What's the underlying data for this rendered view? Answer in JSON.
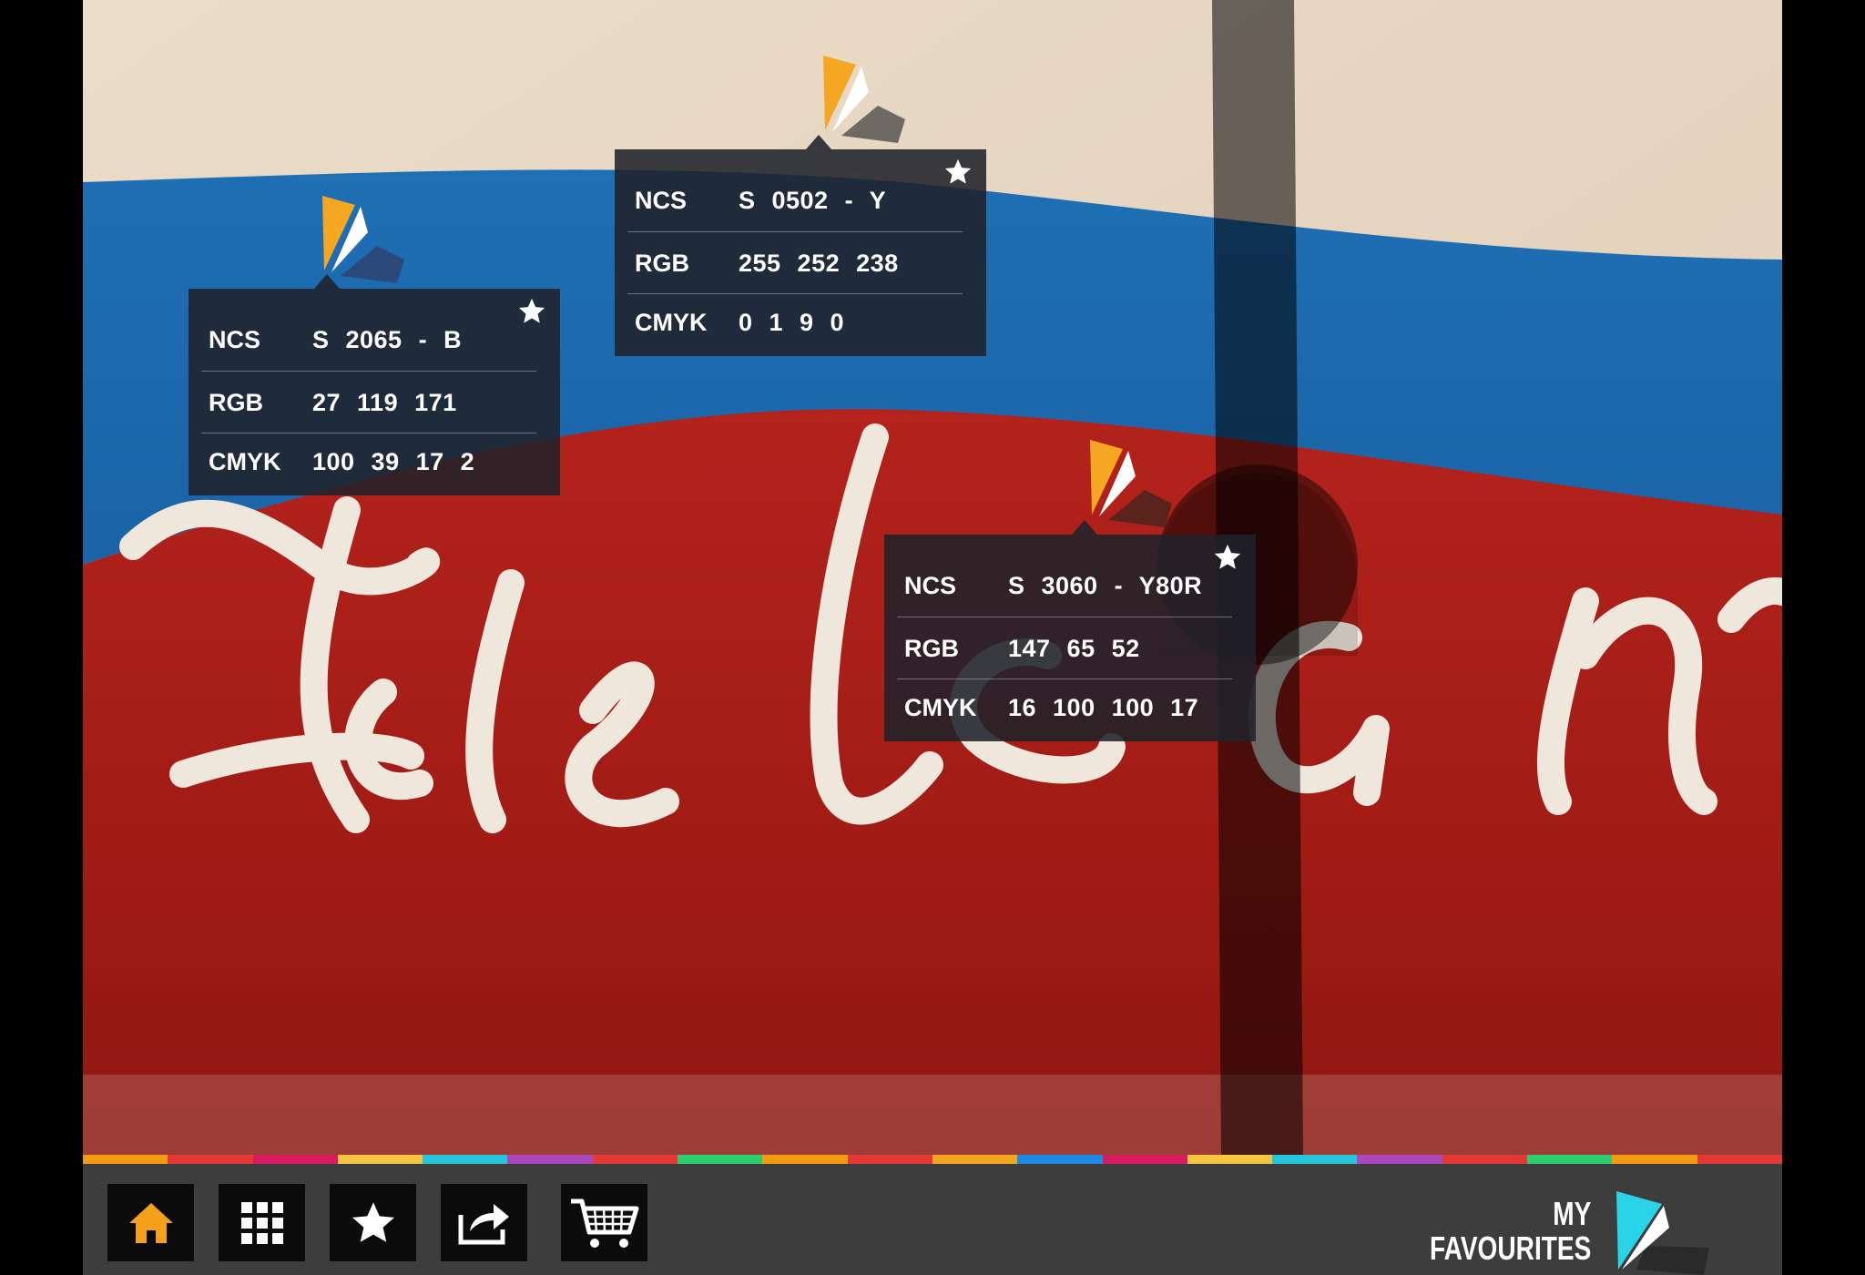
{
  "swatches": [
    {
      "id": "blue",
      "labels": {
        "ncs": "NCS",
        "rgb": "RGB",
        "cmyk": "CMYK"
      },
      "ncs": "S 2065 - B",
      "rgb": "27  119  171",
      "cmyk": "100  39  17  2",
      "pin_colors": {
        "primary": "#f5a623",
        "secondary": "#ffffff",
        "tertiary": "#2b4a7a"
      }
    },
    {
      "id": "cream",
      "labels": {
        "ncs": "NCS",
        "rgb": "RGB",
        "cmyk": "CMYK"
      },
      "ncs": "S 0502 - Y",
      "rgb": "255  252  238",
      "cmyk": "0  1  9  0",
      "pin_colors": {
        "primary": "#f5a623",
        "secondary": "#ffffff",
        "tertiary": "#6e6962"
      }
    },
    {
      "id": "red",
      "labels": {
        "ncs": "NCS",
        "rgb": "RGB",
        "cmyk": "CMYK"
      },
      "ncs": "S 3060 - Y80R",
      "rgb": "147  65  52",
      "cmyk": "16  100  100  17",
      "pin_colors": {
        "primary": "#f5a623",
        "secondary": "#ffffff",
        "tertiary": "#5a231c"
      }
    }
  ],
  "strip_colors": [
    "#f39c12",
    "#e53935",
    "#d81b60",
    "#f5c542",
    "#26c6da",
    "#ab47bc",
    "#e53935",
    "#2ecc71",
    "#f39c12",
    "#e53935",
    "#f5a623",
    "#1e88e5",
    "#d81b60",
    "#f5c542",
    "#26c6da",
    "#ab47bc",
    "#e53935",
    "#2ecc71",
    "#f39c12",
    "#e53935"
  ],
  "toolbar": {
    "buttons": [
      {
        "name": "home-button",
        "icon": "home-icon",
        "color": "#f5a01a"
      },
      {
        "name": "grid-button",
        "icon": "grid-icon",
        "color": "#ffffff"
      },
      {
        "name": "favourites-button",
        "icon": "star-icon",
        "color": "#ffffff"
      },
      {
        "name": "share-button",
        "icon": "share-icon",
        "color": "#ffffff"
      },
      {
        "name": "cart-button",
        "icon": "cart-icon",
        "color": "#ffffff"
      }
    ],
    "brand_line1": "MY",
    "brand_line2": "FAVOURITES",
    "brand_colors": {
      "primary": "#2ad4e8",
      "secondary": "#ffffff",
      "shadow": "#2a2a2a"
    }
  }
}
